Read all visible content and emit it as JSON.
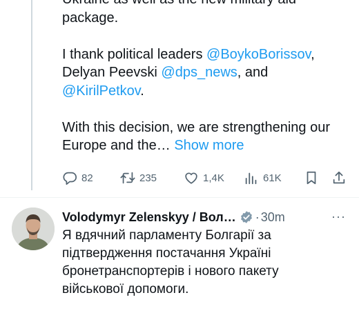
{
  "tweet1": {
    "line1": "Ukraine as well as the new military aid",
    "line2": "package.",
    "p2_text1": "I thank political leaders ",
    "p2_mention1": "@BoykoBorissov",
    "p2_text2": ",",
    "p2_text3": "Delyan Peevski ",
    "p2_mention2": "@dps_news",
    "p2_text4": ", and",
    "p2_mention3": "@KirilPetkov",
    "p2_text5": ".",
    "p3_line1": "With this decision, we are strengthening our",
    "p3_line2": "Europe and the… ",
    "show_more": "Show more",
    "actions": {
      "replies": "82",
      "reposts": "235",
      "likes": "1,4K",
      "views": "61K"
    }
  },
  "tweet2": {
    "author_name": "Volodymyr Zelenskyy / Вол…",
    "dot": "·",
    "time": "30m",
    "more": "···",
    "text_line1": "Я вдячний парламенту Болгарії за",
    "text_line2": "підтвердження постачання Україні",
    "text_line3": "бронетранспортерів і нового пакету",
    "text_line4": "військової допомоги."
  },
  "colors": {
    "link": "#1d9bf0",
    "muted": "#536471",
    "text": "#0f1419",
    "verified_badge": "#829aab"
  },
  "icons": [
    "reply-icon",
    "repost-icon",
    "like-icon",
    "views-icon",
    "bookmark-icon",
    "share-icon",
    "verified-badge-icon"
  ]
}
